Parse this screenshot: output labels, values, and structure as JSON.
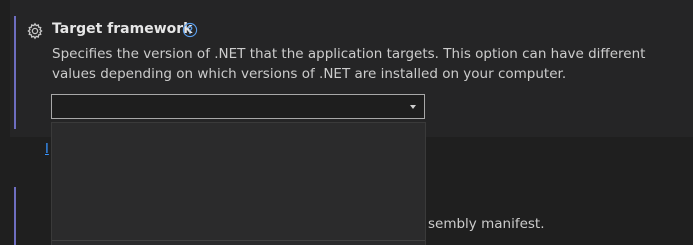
{
  "setting": {
    "title": "Target framework",
    "description": "Specifies the version of .NET that the application targets. This option can have different values depending on which versions of .NET are installed on your computer.",
    "select_value": ""
  },
  "background": {
    "link_fragment": "I",
    "text_fragment": "sembly manifest."
  },
  "icons": {
    "settings": "gear-icon",
    "help": "help-circle-icon",
    "dropdown": "chevron-down-icon"
  },
  "colors": {
    "accent_bar": "#6e6ec0",
    "panel": "#252526",
    "dropdown": "#2b2b2c",
    "link": "#3794ff"
  }
}
